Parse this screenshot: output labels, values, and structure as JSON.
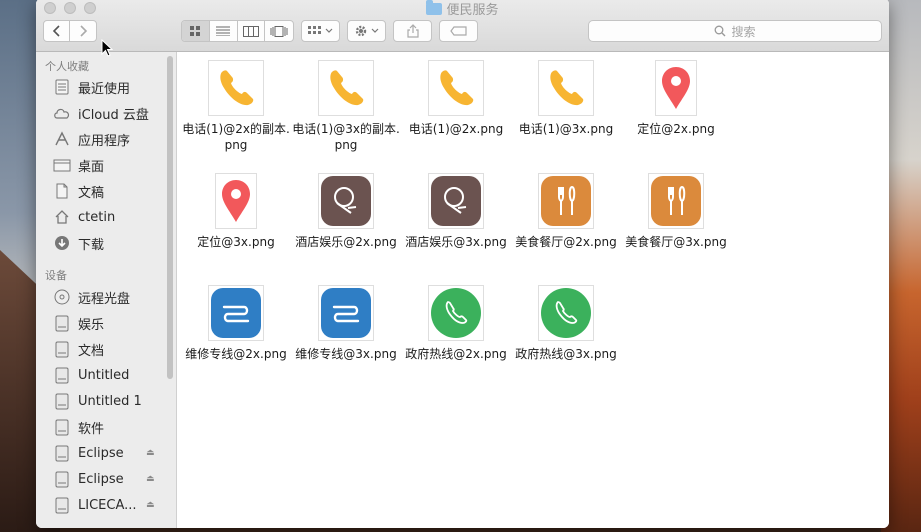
{
  "window": {
    "title": "便民服务"
  },
  "toolbar": {
    "back_label": "<",
    "forward_label": ">",
    "search_placeholder": "搜索"
  },
  "sidebar": {
    "favorites_header": "个人收藏",
    "favorites": [
      {
        "label": "最近使用",
        "icon": "recents-icon"
      },
      {
        "label": "iCloud 云盘",
        "icon": "cloud-icon"
      },
      {
        "label": "应用程序",
        "icon": "applications-icon"
      },
      {
        "label": "桌面",
        "icon": "desktop-icon"
      },
      {
        "label": "文稿",
        "icon": "documents-icon"
      },
      {
        "label": "ctetin",
        "icon": "home-icon"
      },
      {
        "label": "下载",
        "icon": "downloads-icon"
      }
    ],
    "devices_header": "设备",
    "devices": [
      {
        "label": "远程光盘",
        "icon": "optical-disc-icon"
      },
      {
        "label": "娱乐",
        "icon": "disk-icon"
      },
      {
        "label": "文档",
        "icon": "disk-icon"
      },
      {
        "label": "Untitled",
        "icon": "disk-icon"
      },
      {
        "label": "Untitled 1",
        "icon": "disk-icon"
      },
      {
        "label": "软件",
        "icon": "disk-icon"
      },
      {
        "label": "Eclipse",
        "icon": "removable-disk-icon"
      },
      {
        "label": "Eclipse",
        "icon": "removable-disk-icon"
      },
      {
        "label": "LICECA...",
        "icon": "removable-disk-icon"
      }
    ]
  },
  "files": [
    {
      "name": "电话(1)@2x的副本.png",
      "kind": "phone-orange"
    },
    {
      "name": "电话(1)@3x的副本.png",
      "kind": "phone-orange"
    },
    {
      "name": "电话(1)@2x.png",
      "kind": "phone-orange"
    },
    {
      "name": "电话(1)@3x.png",
      "kind": "phone-orange"
    },
    {
      "name": "定位@2x.png",
      "kind": "location-pin"
    },
    {
      "name": "定位@3x.png",
      "kind": "location-pin"
    },
    {
      "name": "酒店娱乐@2x.png",
      "kind": "hotel-brown"
    },
    {
      "name": "酒店娱乐@3x.png",
      "kind": "hotel-brown"
    },
    {
      "name": "美食餐厅@2x.png",
      "kind": "food-orange"
    },
    {
      "name": "美食餐厅@3x.png",
      "kind": "food-orange"
    },
    {
      "name": "维修专线@2x.png",
      "kind": "repair-blue"
    },
    {
      "name": "维修专线@3x.png",
      "kind": "repair-blue"
    },
    {
      "name": "政府热线@2x.png",
      "kind": "hotline-green"
    },
    {
      "name": "政府热线@3x.png",
      "kind": "hotline-green"
    }
  ],
  "colors": {
    "phone_orange": "#f7b532",
    "pin_red": "#f2585b",
    "hotel_brown": "#6b5350",
    "food_orange": "#db8a3c",
    "repair_blue": "#2f7ec5",
    "hotline_green": "#3bb15c"
  }
}
